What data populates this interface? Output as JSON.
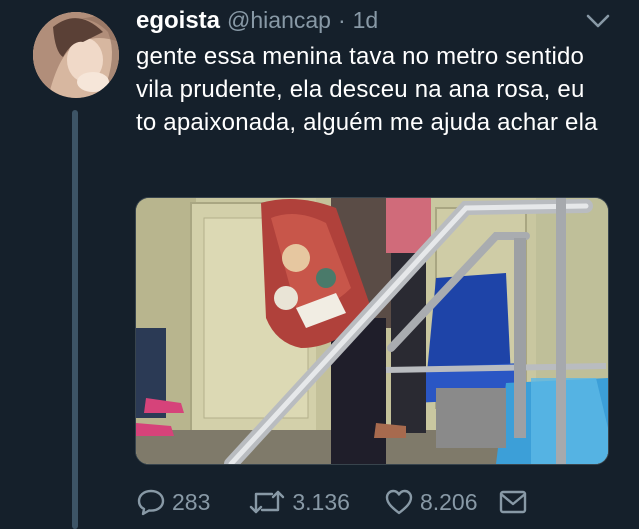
{
  "tweet": {
    "author_name": "egoista",
    "author_handle": "@hiancap",
    "separator": "·",
    "time": "1d",
    "text": "gente essa menina tava no metro sentido vila prudente, ela desceu na ana rosa, eu to apaixonada, alguém me ajuda achar ela",
    "stats": {
      "replies": "283",
      "retweets": "3.136",
      "likes": "8.206"
    }
  },
  "icons": {
    "menu": "chevron-down-icon",
    "reply": "reply-icon",
    "retweet": "retweet-icon",
    "like": "heart-icon",
    "share": "mail-icon"
  },
  "colors": {
    "background": "#15202b",
    "secondary_text": "#8899a6",
    "thread_line": "#3d5466"
  }
}
